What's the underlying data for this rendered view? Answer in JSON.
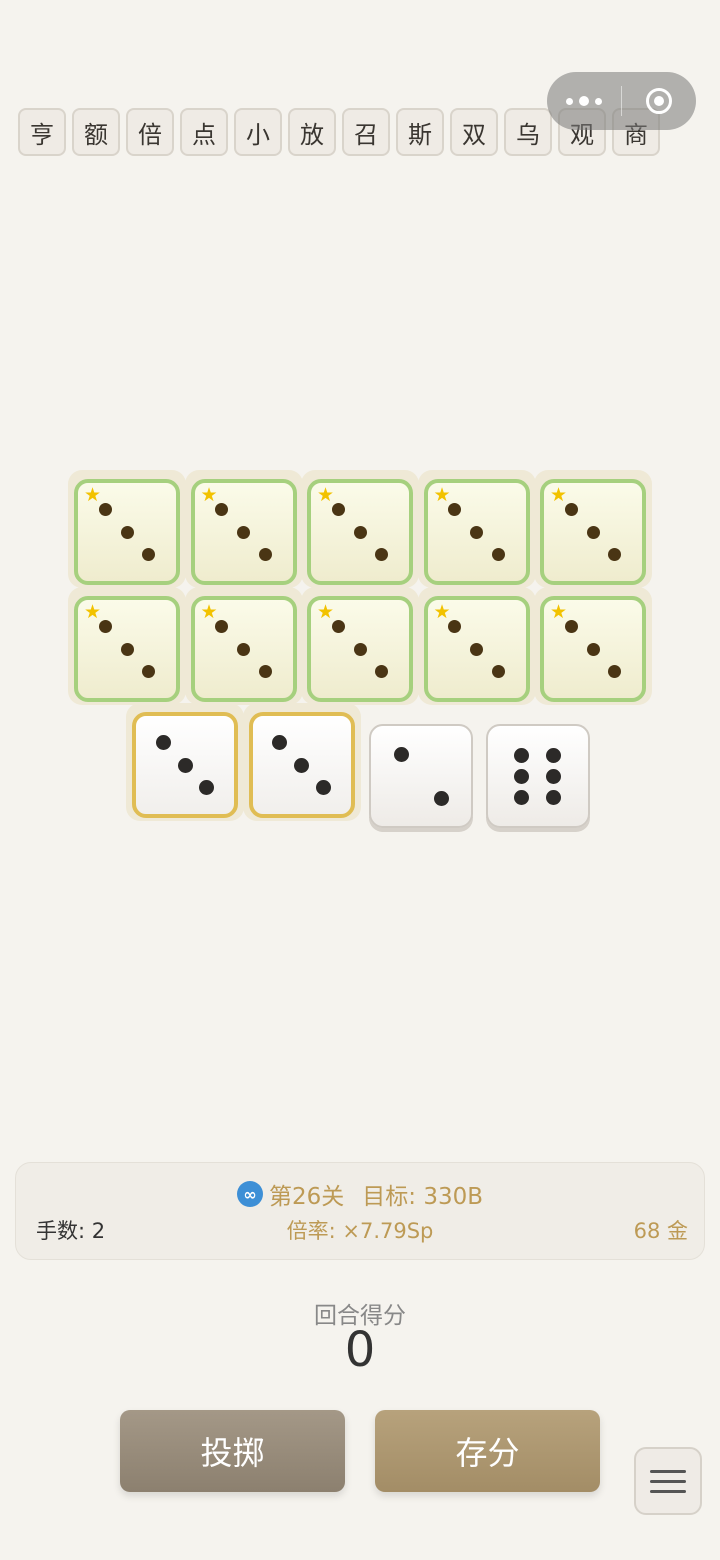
{
  "jokers": [
    "亨",
    "额",
    "倍",
    "点",
    "小",
    "放",
    "召",
    "斯",
    "双",
    "乌",
    "观",
    "商"
  ],
  "dice_rows": [
    {
      "dice": [
        {
          "value": 3,
          "style": "green",
          "star": true
        },
        {
          "value": 3,
          "style": "green",
          "star": true
        },
        {
          "value": 3,
          "style": "green",
          "star": true
        },
        {
          "value": 3,
          "style": "green",
          "star": true
        },
        {
          "value": 3,
          "style": "green",
          "star": true
        }
      ]
    },
    {
      "dice": [
        {
          "value": 3,
          "style": "green",
          "star": true
        },
        {
          "value": 3,
          "style": "green",
          "star": true
        },
        {
          "value": 3,
          "style": "green",
          "star": true
        },
        {
          "value": 3,
          "style": "green",
          "star": true
        },
        {
          "value": 3,
          "style": "green",
          "star": true
        }
      ]
    },
    {
      "dice": [
        {
          "value": 3,
          "style": "gold",
          "star": false
        },
        {
          "value": 3,
          "style": "gold",
          "star": false
        },
        {
          "value": 2,
          "style": "plain",
          "star": false
        },
        {
          "value": 6,
          "style": "plain",
          "star": false
        }
      ]
    }
  ],
  "star_glyph": "★",
  "info": {
    "mode_icon": "infinity-icon",
    "level": "第26关",
    "target": "目标: 330B",
    "hands": "手数: 2",
    "multiplier": "倍率: ×7.79Sp",
    "gold": "68 金"
  },
  "score": {
    "label": "回合得分",
    "value": "0"
  },
  "buttons": {
    "roll": "投掷",
    "save": "存分"
  },
  "colors": {
    "accent_gold": "#bd9a55",
    "green_border": "#a6d07e",
    "gold_border": "#e0bd54"
  }
}
